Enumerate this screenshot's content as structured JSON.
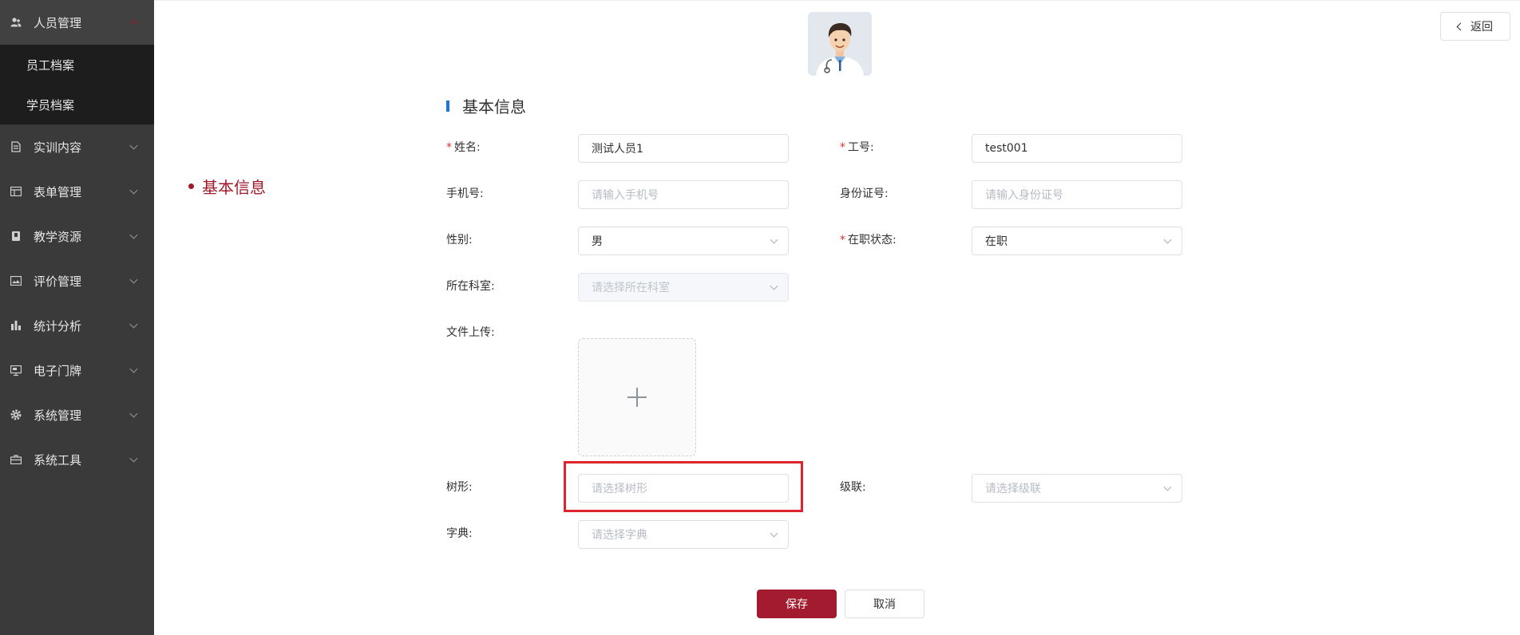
{
  "sidebar": {
    "head": {
      "label": "人员管理",
      "icon": "users-icon"
    },
    "sub_items": [
      {
        "label": "员工档案"
      },
      {
        "label": "学员档案"
      }
    ],
    "items": [
      {
        "label": "实训内容",
        "icon": "document-icon"
      },
      {
        "label": "表单管理",
        "icon": "form-icon"
      },
      {
        "label": "教学资源",
        "icon": "book-icon"
      },
      {
        "label": "评价管理",
        "icon": "image-icon"
      },
      {
        "label": "统计分析",
        "icon": "bar-chart-icon"
      },
      {
        "label": "电子门牌",
        "icon": "monitor-icon"
      },
      {
        "label": "系统管理",
        "icon": "gear-icon"
      },
      {
        "label": "系统工具",
        "icon": "toolbox-icon"
      }
    ]
  },
  "header": {
    "back_label": "返回"
  },
  "anchor": {
    "label": "基本信息"
  },
  "section": {
    "title": "基本信息"
  },
  "form": {
    "name": {
      "label": "姓名:",
      "value": "测试人员1",
      "required": true
    },
    "job_no": {
      "label": "工号:",
      "value": "test001",
      "required": true
    },
    "phone": {
      "label": "手机号:",
      "placeholder": "请输入手机号"
    },
    "id_card": {
      "label": "身份证号:",
      "placeholder": "请输入身份证号"
    },
    "gender": {
      "label": "性别:",
      "value": "男"
    },
    "job_status": {
      "label": "在职状态:",
      "value": "在职",
      "required": true
    },
    "department": {
      "label": "所在科室:",
      "placeholder": "请选择所在科室"
    },
    "upload": {
      "label": "文件上传:"
    },
    "tree": {
      "label": "树形:",
      "placeholder": "请选择树形"
    },
    "cascade": {
      "label": "级联:",
      "placeholder": "请选择级联"
    },
    "dict": {
      "label": "字典:",
      "placeholder": "请选择字典"
    }
  },
  "buttons": {
    "save": "保存",
    "cancel": "取消"
  },
  "colors": {
    "sidebar_bg": "#3a3a3a",
    "accent": "#a31b2e",
    "section_bar": "#1a73e8",
    "required": "#e0342b",
    "highlight": "#e0242d"
  }
}
